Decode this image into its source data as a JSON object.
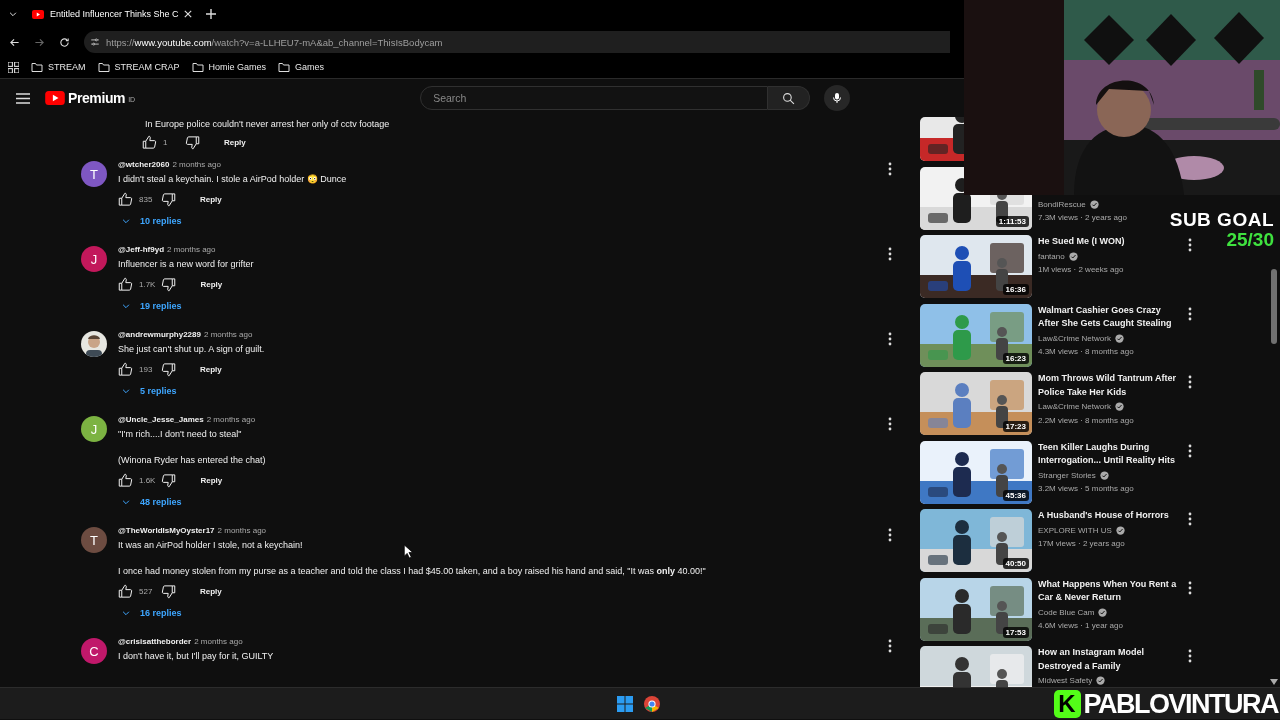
{
  "browser": {
    "tab": {
      "title": "Entitled Influencer Thinks She C",
      "selected": true
    },
    "url": {
      "scheme": "https://",
      "host": "www.youtube.com",
      "path": "/watch?v=a-LLHEU7-mA&ab_channel=ThisIsBodycam"
    },
    "forward_disabled": true,
    "bookmarks": [
      "STREAM",
      "STREAM CRAP",
      "Homie Games",
      "Games"
    ]
  },
  "masthead": {
    "logo": "Premium",
    "region": "ID",
    "search": {
      "placeholder": "Search"
    }
  },
  "partial_reply": {
    "text": "In Europe police couldn't never arrest her only of cctv footage",
    "likes": "1",
    "reply": "Reply"
  },
  "comments": [
    {
      "avatar": {
        "kind": "letter",
        "letter": "T",
        "color": "#7e57c2"
      },
      "author": "@wtcher2060",
      "time": "2 months ago",
      "lines": [
        "I didn't steal a keychain. I stole a AirPod holder 😳 Dunce"
      ],
      "likes": "835",
      "reply": "Reply",
      "replies": "10 replies"
    },
    {
      "avatar": {
        "kind": "letter",
        "letter": "J",
        "color": "#c2185b"
      },
      "author": "@Jeff-hf9yd",
      "time": "2 months ago",
      "lines": [
        "Influencer is a new word for grifter"
      ],
      "likes": "1.7K",
      "reply": "Reply",
      "replies": "19 replies"
    },
    {
      "avatar": {
        "kind": "picture"
      },
      "author": "@andrewmurphy2289",
      "time": "2 months ago",
      "lines": [
        "She just can't shut up. A sign of guilt."
      ],
      "likes": "193",
      "reply": "Reply",
      "replies": "5 replies"
    },
    {
      "avatar": {
        "kind": "letter",
        "letter": "J",
        "color": "#7cb342"
      },
      "author": "@Uncle_Jesse_James",
      "time": "2 months ago",
      "lines": [
        "\"I'm rich....I don't need to steal\"",
        "(Winona Ryder has entered the chat)"
      ],
      "likes": "1.6K",
      "reply": "Reply",
      "replies": "48 replies"
    },
    {
      "avatar": {
        "kind": "letter",
        "letter": "T",
        "color": "#6d4c41"
      },
      "author": "@TheWorldIsMyOyster17",
      "time": "2 months ago",
      "lines": [
        "It was an AirPod holder I stole, not a keychain!",
        "I once had money stolen from my purse as a teacher and told the class I had $45.00 taken, and a boy raised his hand and said, \"It was **only** 40.00!\""
      ],
      "likes": "527",
      "reply": "Reply",
      "replies": "16 replies"
    },
    {
      "avatar": {
        "kind": "letter",
        "letter": "C",
        "color": "#c0186a"
      },
      "author": "@crisisattheborder",
      "time": "2 months ago",
      "lines": [
        "I don't have it, but I'll pay for it, GUILTY"
      ]
    }
  ],
  "sidebar": {
    "videos": [
      {
        "kind": "thumbnail_only"
      },
      {
        "kind": "video",
        "channel": "BondiRescue",
        "verified": true,
        "meta": "7.3M views · 2 years ago",
        "duration": "1:11:53"
      },
      {
        "kind": "video",
        "title": "He Sued Me (I WON)",
        "channel": "fantano",
        "verified": true,
        "meta": "1M views · 2 weeks ago",
        "duration": "16:36"
      },
      {
        "kind": "video",
        "title": "Walmart Cashier Goes Crazy After She Gets Caught Stealing",
        "channel": "Law&Crime Network",
        "verified": true,
        "meta": "4.3M views · 8 months ago",
        "duration": "16:23"
      },
      {
        "kind": "video",
        "title": "Mom Throws Wild Tantrum After Police Take Her Kids",
        "channel": "Law&Crime Network",
        "verified": true,
        "meta": "2.2M views · 8 months ago",
        "duration": "17:23"
      },
      {
        "kind": "video",
        "title": "Teen Killer Laughs During Interrogation... Until Reality Hits",
        "channel": "Stranger Stories",
        "verified": true,
        "meta": "3.2M views · 5 months ago",
        "duration": "45:36"
      },
      {
        "kind": "video",
        "title": "A Husband's House of Horrors",
        "channel": "EXPLORE WITH US",
        "verified": true,
        "meta": "17M views · 2 years ago",
        "duration": "40:50"
      },
      {
        "kind": "video",
        "title": "What Happens When You Rent a Car & Never Return",
        "channel": "Code Blue Cam",
        "verified": true,
        "meta": "4.6M views · 1 year ago",
        "duration": "17:53"
      },
      {
        "kind": "video",
        "title": "How an Instagram Model Destroyed a Family",
        "channel": "Midwest Safety",
        "verified": true
      }
    ]
  },
  "stream_overlay": {
    "webcam": {
      "kind": "picture"
    },
    "sub_goal": {
      "label": "SUB GOAL",
      "count": "25/30"
    },
    "streamer": {
      "logo_letter": "K",
      "name": "PABLOVINTURA"
    }
  },
  "taskbar": {
    "apps": [
      {
        "kind": "windows"
      },
      {
        "kind": "browser"
      }
    ]
  }
}
